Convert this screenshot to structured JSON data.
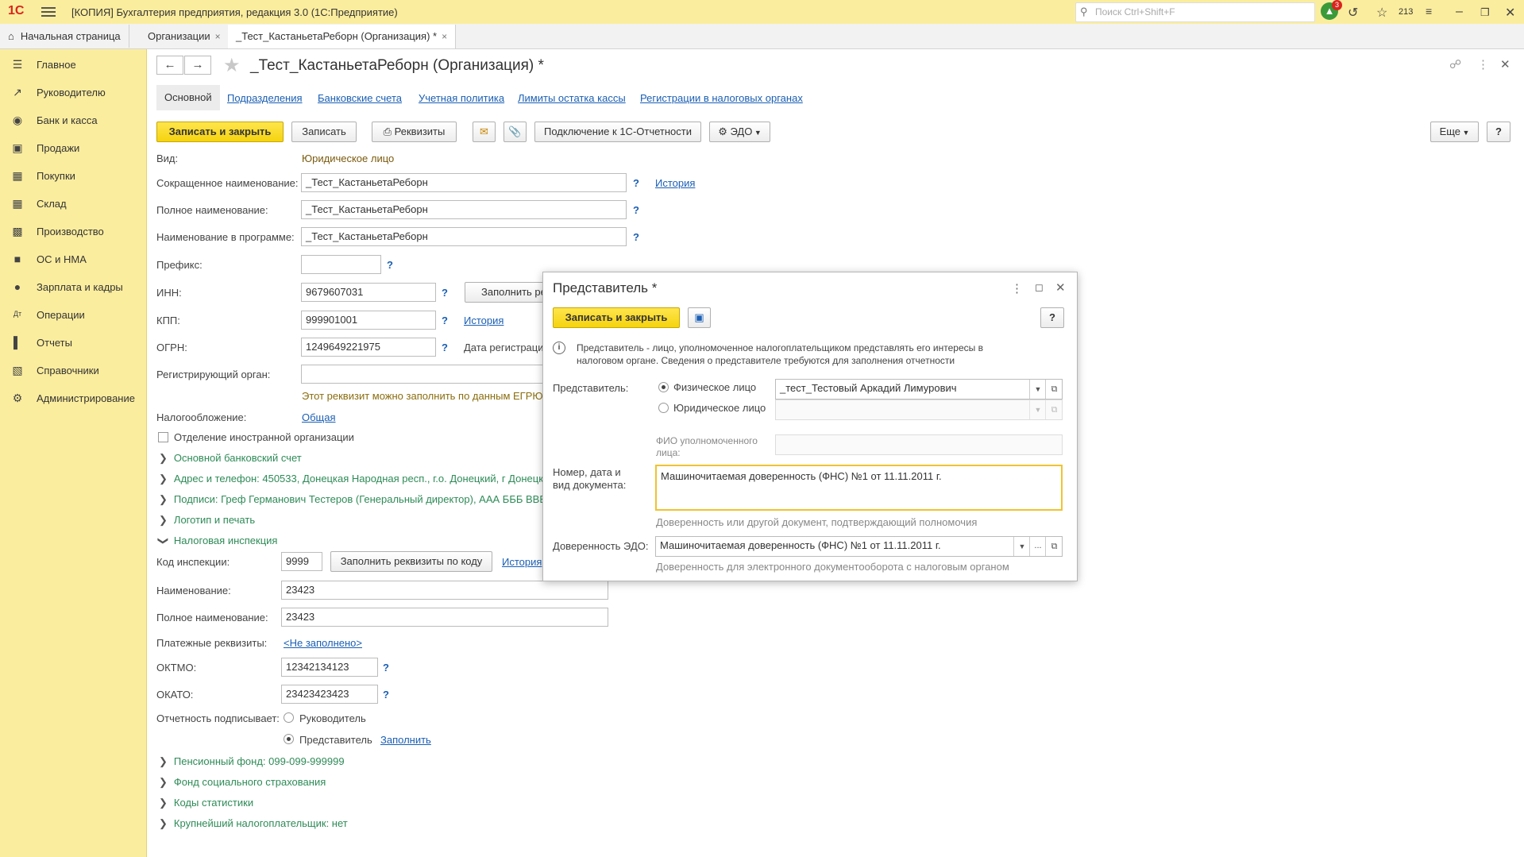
{
  "app": {
    "logo": "1С",
    "title": "[КОПИЯ] Бухгалтерия предприятия, редакция 3.0  (1С:Предприятие)",
    "search_placeholder": "Поиск Ctrl+Shift+F",
    "notifications_count": "3",
    "counter": "213"
  },
  "tabs": {
    "home": "Начальная страница",
    "orgs": "Организации",
    "current": "_Тест_КастаньетаРеборн (Организация) *",
    "close": "×"
  },
  "sidebar": {
    "items": [
      {
        "label": "Главное",
        "icon": "menu-icon"
      },
      {
        "label": "Руководителю",
        "icon": "trend-icon"
      },
      {
        "label": "Банк и касса",
        "icon": "coin-icon"
      },
      {
        "label": "Продажи",
        "icon": "bag-icon"
      },
      {
        "label": "Покупки",
        "icon": "cart-icon"
      },
      {
        "label": "Склад",
        "icon": "grid-icon"
      },
      {
        "label": "Производство",
        "icon": "factory-icon"
      },
      {
        "label": "ОС и НМА",
        "icon": "truck-icon"
      },
      {
        "label": "Зарплата и кадры",
        "icon": "person-icon"
      },
      {
        "label": "Операции",
        "icon": "dt-kt-icon"
      },
      {
        "label": "Отчеты",
        "icon": "chart-icon"
      },
      {
        "label": "Справочники",
        "icon": "book-icon"
      },
      {
        "label": "Администрирование",
        "icon": "gear-icon"
      }
    ]
  },
  "form": {
    "title": "_Тест_КастаньетаРеборн (Организация) *",
    "subtabs": [
      "Основной",
      "Подразделения",
      "Банковские счета",
      "Учетная политика",
      "Лимиты остатка кассы",
      "Регистрации в налоговых органах"
    ],
    "toolbar": {
      "save_close": "Записать и закрыть",
      "save": "Записать",
      "requisites": "Реквизиты",
      "connect": "Подключение к 1С-Отчетности",
      "edo": "ЭДО",
      "more": "Еще",
      "help": "?"
    },
    "fields": {
      "kind_label": "Вид:",
      "kind_value": "Юридическое лицо",
      "short_name_label": "Сокращенное наименование:",
      "short_name": "_Тест_КастаньетаРеборн",
      "full_name_label": "Полное наименование:",
      "full_name": "_Тест_КастаньетаРеборн",
      "program_name_label": "Наименование в программе:",
      "program_name": "_Тест_КастаньетаРеборн",
      "prefix_label": "Префикс:",
      "prefix": "",
      "inn_label": "ИНН:",
      "inn": "9679607031",
      "fill_btn": "Заполнить ре",
      "kpp_label": "КПП:",
      "kpp": "999901001",
      "ogrn_label": "ОГРН:",
      "ogrn": "1249649221975",
      "reg_date_label": "Дата регистраци",
      "reg_organ_label": "Регистрирующий орган:",
      "reg_organ_hint": "Этот реквизит можно заполнить по данным ЕГРЮЛ",
      "tax_label": "Налогообложение:",
      "tax_link": "Общая",
      "foreign_label": "Отделение иностранной организации",
      "history": "История",
      "question": "?"
    },
    "sections": {
      "bank": "Основной банковский счет",
      "address": "Адрес и телефон: 450533, Донецкая Народная респ., г.о. Донецкий, г Донецк",
      "signatures": "Подписи: Греф Германович Тестеров (Генеральный директор), ААА БББ ВВВ",
      "logo": "Логотип и печать",
      "tax_inspection": "Налоговая инспекция",
      "pension": "Пенсионный фонд: 099-099-999999",
      "social": "Фонд социального страхования",
      "stat_codes": "Коды статистики",
      "largest": "Крупнейший налогоплательщик: нет"
    },
    "inspection": {
      "code_label": "Код инспекции:",
      "code": "9999",
      "fill_by_code": "Заполнить реквизиты по коду",
      "history": "История",
      "name_label": "Наименование:",
      "name": "23423",
      "full_name_label": "Полное наименование:",
      "full_name": "23423",
      "payment_label": "Платежные реквизиты:",
      "payment_link": "<Не заполнено>",
      "oktmo_label": "ОКТМО:",
      "oktmo": "12342134123",
      "okato_label": "ОКАТО:",
      "okato": "23423423423",
      "signer_label": "Отчетность подписывает:",
      "signer_head": "Руководитель",
      "signer_rep": "Представитель",
      "fill_link": "Заполнить"
    }
  },
  "dialog": {
    "title": "Представитель *",
    "save_close": "Записать и закрыть",
    "help": "?",
    "info": "Представитель - лицо, уполномоченное налогоплательщиком представлять его интересы в",
    "info2": "налоговом органе. Сведения о представителе требуются для заполнения отчетности",
    "rep_label": "Представитель:",
    "person": "Физическое лицо",
    "person_value": "_тест_Тестовый Аркадий Лимурович",
    "legal": "Юридическое лицо",
    "fio_label1": "ФИО уполномоченного",
    "fio_label2": "лица:",
    "doc_label1": "Номер, дата и",
    "doc_label2": "вид документа:",
    "doc_value": "Машиночитаемая доверенность (ФНС) №1 от 11.11.2011 г.",
    "doc_hint": "Доверенность или другой документ, подтверждающий полномочия",
    "edo_label": "Доверенность ЭДО:",
    "edo_value": "Машиночитаемая доверенность (ФНС) №1 от 11.11.2011 г.",
    "edo_hint": "Доверенность для электронного документооборота с налоговым органом",
    "dots": "..."
  }
}
